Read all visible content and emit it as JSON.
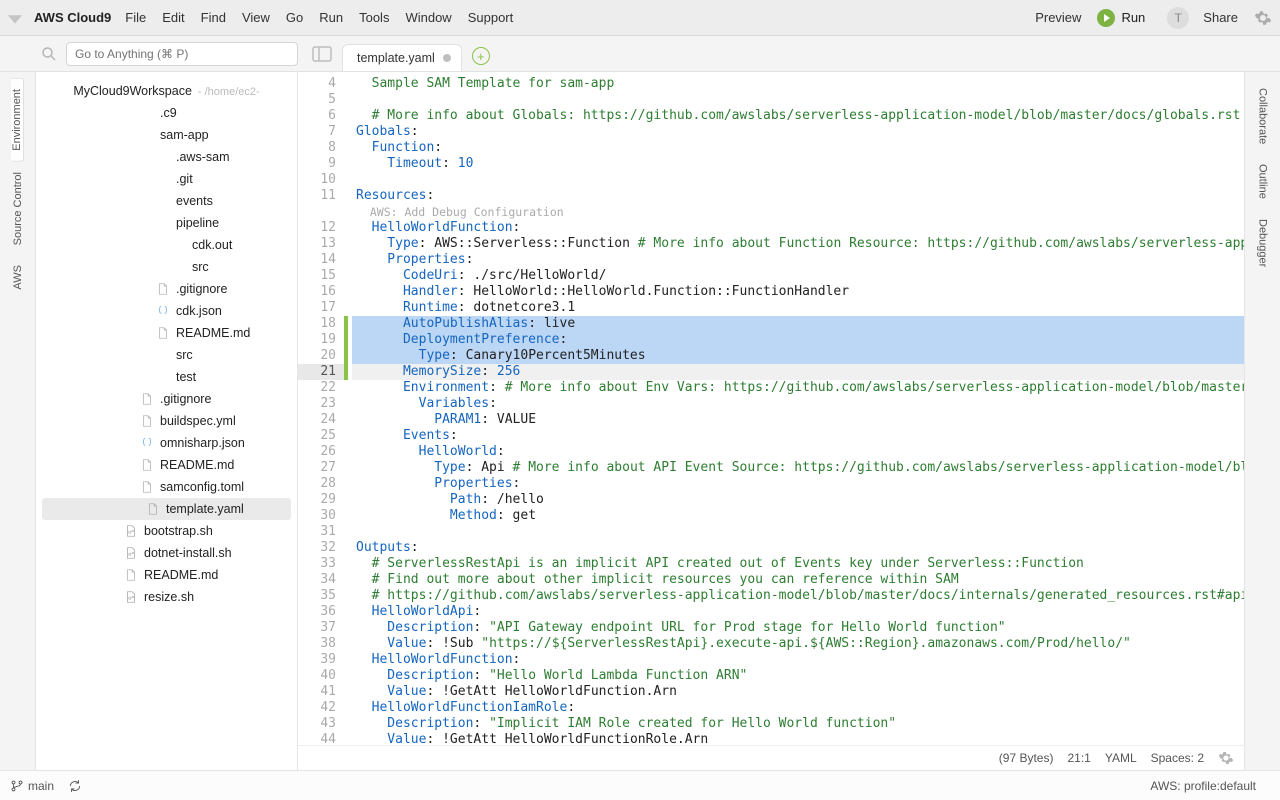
{
  "menubar": {
    "brand": "AWS Cloud9",
    "items": [
      "File",
      "Edit",
      "Find",
      "View",
      "Go",
      "Run",
      "Tools",
      "Window",
      "Support"
    ],
    "preview": "Preview",
    "run": "Run",
    "share": "Share",
    "avatar_initial": "T"
  },
  "search": {
    "placeholder": "Go to Anything (⌘ P)"
  },
  "tabs": {
    "active": {
      "label": "template.yaml",
      "dirty": true
    }
  },
  "left_rail": [
    "Environment",
    "Source Control",
    "AWS"
  ],
  "right_rail": [
    "Collaborate",
    "Outline",
    "Debugger"
  ],
  "filetree": {
    "root_name": "MyCloud9Workspace",
    "root_path": "- /home/ec2-",
    "nodes": [
      {
        "depth": 1,
        "label": ".c9",
        "icon": "folder"
      },
      {
        "depth": 1,
        "label": "sam-app",
        "icon": "folder"
      },
      {
        "depth": 2,
        "label": ".aws-sam",
        "icon": "folder"
      },
      {
        "depth": 2,
        "label": ".git",
        "icon": "folder"
      },
      {
        "depth": 2,
        "label": "events",
        "icon": "folder"
      },
      {
        "depth": 2,
        "label": "pipeline",
        "icon": "folder"
      },
      {
        "depth": 3,
        "label": "cdk.out",
        "icon": "folder"
      },
      {
        "depth": 3,
        "label": "src",
        "icon": "folder"
      },
      {
        "depth": 2,
        "label": ".gitignore",
        "icon": "file"
      },
      {
        "depth": 2,
        "label": "cdk.json",
        "icon": "json"
      },
      {
        "depth": 2,
        "label": "README.md",
        "icon": "file"
      },
      {
        "depth": 2,
        "label": "src",
        "icon": "folder"
      },
      {
        "depth": 2,
        "label": "test",
        "icon": "folder"
      },
      {
        "depth": 1,
        "label": ".gitignore",
        "icon": "file"
      },
      {
        "depth": 1,
        "label": "buildspec.yml",
        "icon": "file"
      },
      {
        "depth": 1,
        "label": "omnisharp.json",
        "icon": "json"
      },
      {
        "depth": 1,
        "label": "README.md",
        "icon": "file"
      },
      {
        "depth": 1,
        "label": "samconfig.toml",
        "icon": "file"
      },
      {
        "depth": 1,
        "label": "template.yaml",
        "icon": "file",
        "selected": true
      },
      {
        "depth": 0,
        "label": "bootstrap.sh",
        "icon": "script"
      },
      {
        "depth": 0,
        "label": "dotnet-install.sh",
        "icon": "script"
      },
      {
        "depth": 0,
        "label": "README.md",
        "icon": "file"
      },
      {
        "depth": 0,
        "label": "resize.sh",
        "icon": "script"
      }
    ]
  },
  "editor": {
    "first_line": 4,
    "highlight": [
      18,
      19,
      20
    ],
    "cursor_line": 21,
    "green_marker_lines": [
      18,
      19,
      20,
      21
    ],
    "codelens_after_line": 11,
    "codelens_text": "AWS: Add Debug Configuration",
    "lines": [
      [
        [
          "s",
          "  Sample SAM Template for sam-app"
        ]
      ],
      [],
      [
        [
          "c",
          "  # More info about Globals: https://github.com/awslabs/serverless-application-model/blob/master/docs/globals.rst"
        ]
      ],
      [
        [
          "k",
          "Globals"
        ],
        [
          "v",
          ":"
        ]
      ],
      [
        [
          "k",
          "  Function"
        ],
        [
          "v",
          ":"
        ]
      ],
      [
        [
          "k",
          "    Timeout"
        ],
        [
          "v",
          ": "
        ],
        [
          "k",
          "10"
        ]
      ],
      [],
      [
        [
          "k",
          "Resources"
        ],
        [
          "v",
          ":"
        ]
      ],
      [
        [
          "k",
          "  HelloWorldFunction"
        ],
        [
          "v",
          ":"
        ]
      ],
      [
        [
          "k",
          "    Type"
        ],
        [
          "v",
          ": "
        ],
        [
          "v",
          "AWS::Serverless::Function "
        ],
        [
          "c",
          "# More info about Function Resource: https://github.com/awslabs/serverless-applicati"
        ]
      ],
      [
        [
          "k",
          "    Properties"
        ],
        [
          "v",
          ":"
        ]
      ],
      [
        [
          "k",
          "      CodeUri"
        ],
        [
          "v",
          ": ./src/HelloWorld/"
        ]
      ],
      [
        [
          "k",
          "      Handler"
        ],
        [
          "v",
          ": HelloWorld::HelloWorld.Function::FunctionHandler"
        ]
      ],
      [
        [
          "k",
          "      Runtime"
        ],
        [
          "v",
          ": dotnetcore3.1"
        ]
      ],
      [
        [
          "k",
          "      AutoPublishAlias"
        ],
        [
          "v",
          ": live"
        ]
      ],
      [
        [
          "k",
          "      DeploymentPreference"
        ],
        [
          "v",
          ":"
        ]
      ],
      [
        [
          "k",
          "        Type"
        ],
        [
          "v",
          ": Canary10Percent5Minutes"
        ]
      ],
      [
        [
          "k",
          "      MemorySize"
        ],
        [
          "v",
          ": "
        ],
        [
          "k",
          "256"
        ]
      ],
      [
        [
          "k",
          "      Environment"
        ],
        [
          "v",
          ": "
        ],
        [
          "c",
          "# More info about Env Vars: https://github.com/awslabs/serverless-application-model/blob/master/versi"
        ]
      ],
      [
        [
          "k",
          "        Variables"
        ],
        [
          "v",
          ":"
        ]
      ],
      [
        [
          "k",
          "          PARAM1"
        ],
        [
          "v",
          ": VALUE"
        ]
      ],
      [
        [
          "k",
          "      Events"
        ],
        [
          "v",
          ":"
        ]
      ],
      [
        [
          "k",
          "        HelloWorld"
        ],
        [
          "v",
          ":"
        ]
      ],
      [
        [
          "k",
          "          Type"
        ],
        [
          "v",
          ": Api "
        ],
        [
          "c",
          "# More info about API Event Source: https://github.com/awslabs/serverless-application-model/blob/mas"
        ]
      ],
      [
        [
          "k",
          "          Properties"
        ],
        [
          "v",
          ":"
        ]
      ],
      [
        [
          "k",
          "            Path"
        ],
        [
          "v",
          ": /hello"
        ]
      ],
      [
        [
          "k",
          "            Method"
        ],
        [
          "v",
          ": get"
        ]
      ],
      [],
      [
        [
          "k",
          "Outputs"
        ],
        [
          "v",
          ":"
        ]
      ],
      [
        [
          "c",
          "  # ServerlessRestApi is an implicit API created out of Events key under Serverless::Function"
        ]
      ],
      [
        [
          "c",
          "  # Find out more about other implicit resources you can reference within SAM"
        ]
      ],
      [
        [
          "c",
          "  # https://github.com/awslabs/serverless-application-model/blob/master/docs/internals/generated_resources.rst#api"
        ]
      ],
      [
        [
          "k",
          "  HelloWorldApi"
        ],
        [
          "v",
          ":"
        ]
      ],
      [
        [
          "k",
          "    Description"
        ],
        [
          "v",
          ": "
        ],
        [
          "s",
          "\"API Gateway endpoint URL for Prod stage for Hello World function\""
        ]
      ],
      [
        [
          "k",
          "    Value"
        ],
        [
          "v",
          ": !Sub "
        ],
        [
          "s",
          "\"https://${ServerlessRestApi}.execute-api.${AWS::Region}.amazonaws.com/Prod/hello/\""
        ]
      ],
      [
        [
          "k",
          "  HelloWorldFunction"
        ],
        [
          "v",
          ":"
        ]
      ],
      [
        [
          "k",
          "    Description"
        ],
        [
          "v",
          ": "
        ],
        [
          "s",
          "\"Hello World Lambda Function ARN\""
        ]
      ],
      [
        [
          "k",
          "    Value"
        ],
        [
          "v",
          ": !GetAtt HelloWorldFunction.Arn"
        ]
      ],
      [
        [
          "k",
          "  HelloWorldFunctionIamRole"
        ],
        [
          "v",
          ":"
        ]
      ],
      [
        [
          "k",
          "    Description"
        ],
        [
          "v",
          ": "
        ],
        [
          "s",
          "\"Implicit IAM Role created for Hello World function\""
        ]
      ],
      [
        [
          "k",
          "    Value"
        ],
        [
          "v",
          ": !GetAtt HelloWorldFunctionRole.Arn"
        ]
      ],
      []
    ]
  },
  "editor_status": {
    "bytes": "(97 Bytes)",
    "cursor": "21:1",
    "lang": "YAML",
    "spaces": "Spaces: 2"
  },
  "statusbar": {
    "branch": "main",
    "aws_profile": "AWS: profile:default"
  }
}
